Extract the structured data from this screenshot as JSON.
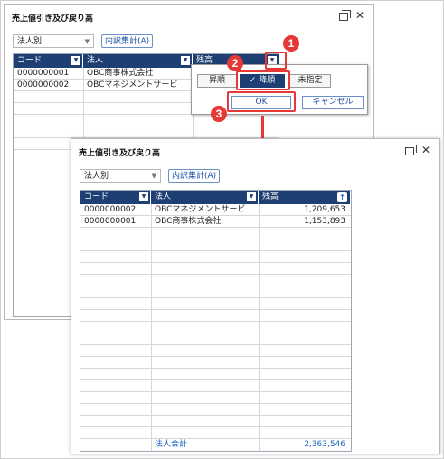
{
  "back": {
    "title": "売上値引き及び戻り高",
    "select_value": "法人別",
    "breakdown_btn": "内訳集計(A)",
    "headers": [
      "コード",
      "法人",
      "残高"
    ],
    "rows": [
      {
        "code": "0000000001",
        "corp": "OBC商事株式会社"
      },
      {
        "code": "0000000002",
        "corp": "OBCマネジメントサービ"
      }
    ]
  },
  "popup": {
    "asc": "昇順",
    "desc": "降順",
    "check": "✓",
    "none": "未指定",
    "ok": "OK",
    "cancel": "キャンセル"
  },
  "badges": [
    "1",
    "2",
    "3"
  ],
  "front": {
    "title": "売上値引き及び戻り高",
    "select_value": "法人別",
    "breakdown_btn": "内訳集計(A)",
    "headers": [
      "コード",
      "法人",
      "残高"
    ],
    "rows": [
      {
        "code": "0000000002",
        "corp": "OBCマネジメントサービ",
        "balance": "1,209,653"
      },
      {
        "code": "0000000001",
        "corp": "OBC商事株式会社",
        "balance": "1,153,893"
      }
    ],
    "total_label": "法人合計",
    "total_value": "2,363,546"
  },
  "icons": {
    "restore": "restore-icon",
    "close": "close-icon",
    "dropdown": "chevron-down-icon",
    "sort_up": "sort-ascending-arrow-icon"
  }
}
